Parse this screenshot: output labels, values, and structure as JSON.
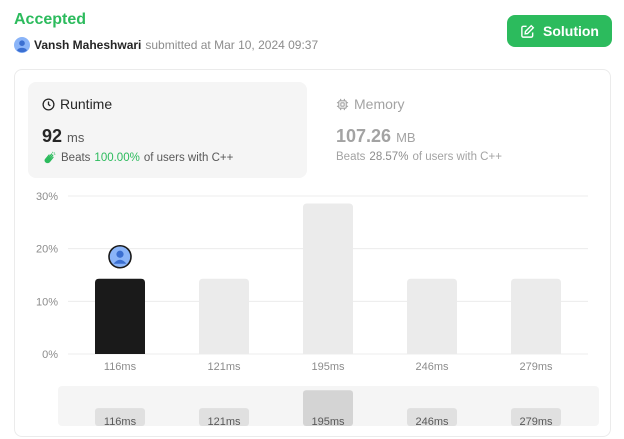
{
  "submission": {
    "status": "Accepted",
    "user": "Vansh Maheshwari",
    "submitted_text": "submitted at Mar 10, 2024 09:37",
    "solution_label": "Solution"
  },
  "runtime": {
    "title": "Runtime",
    "value": "92",
    "unit": "ms",
    "beats_label": "Beats",
    "beats_pct": "100.00%",
    "beats_suffix": "of users with C++"
  },
  "memory": {
    "title": "Memory",
    "value": "107.26",
    "unit": "MB",
    "beats_label": "Beats",
    "beats_pct": "28.57%",
    "beats_suffix": "of users with C++"
  },
  "colors": {
    "accent": "#2cbb5d",
    "selected_bar": "#1a1a1a",
    "bar": "#ebebeb",
    "nav_bar": "#e0e0e0",
    "nav_bar_selected": "#d4d4d4"
  },
  "icons": [
    "user-avatar-icon",
    "edit-icon",
    "clock-icon",
    "chip-icon",
    "clap-icon"
  ],
  "chart_data": {
    "type": "bar",
    "categories": [
      "116ms",
      "121ms",
      "195ms",
      "246ms",
      "279ms"
    ],
    "values": [
      14.29,
      14.29,
      28.57,
      14.29,
      14.29
    ],
    "ylim": [
      0,
      30
    ],
    "yticks": [
      "0%",
      "10%",
      "20%",
      "30%"
    ],
    "selected_index": 0,
    "grid": true,
    "navigator": {
      "labels": [
        "116ms",
        "121ms",
        "195ms",
        "246ms",
        "279ms"
      ],
      "values": [
        14.29,
        14.29,
        28.57,
        14.29,
        14.29
      ]
    }
  }
}
